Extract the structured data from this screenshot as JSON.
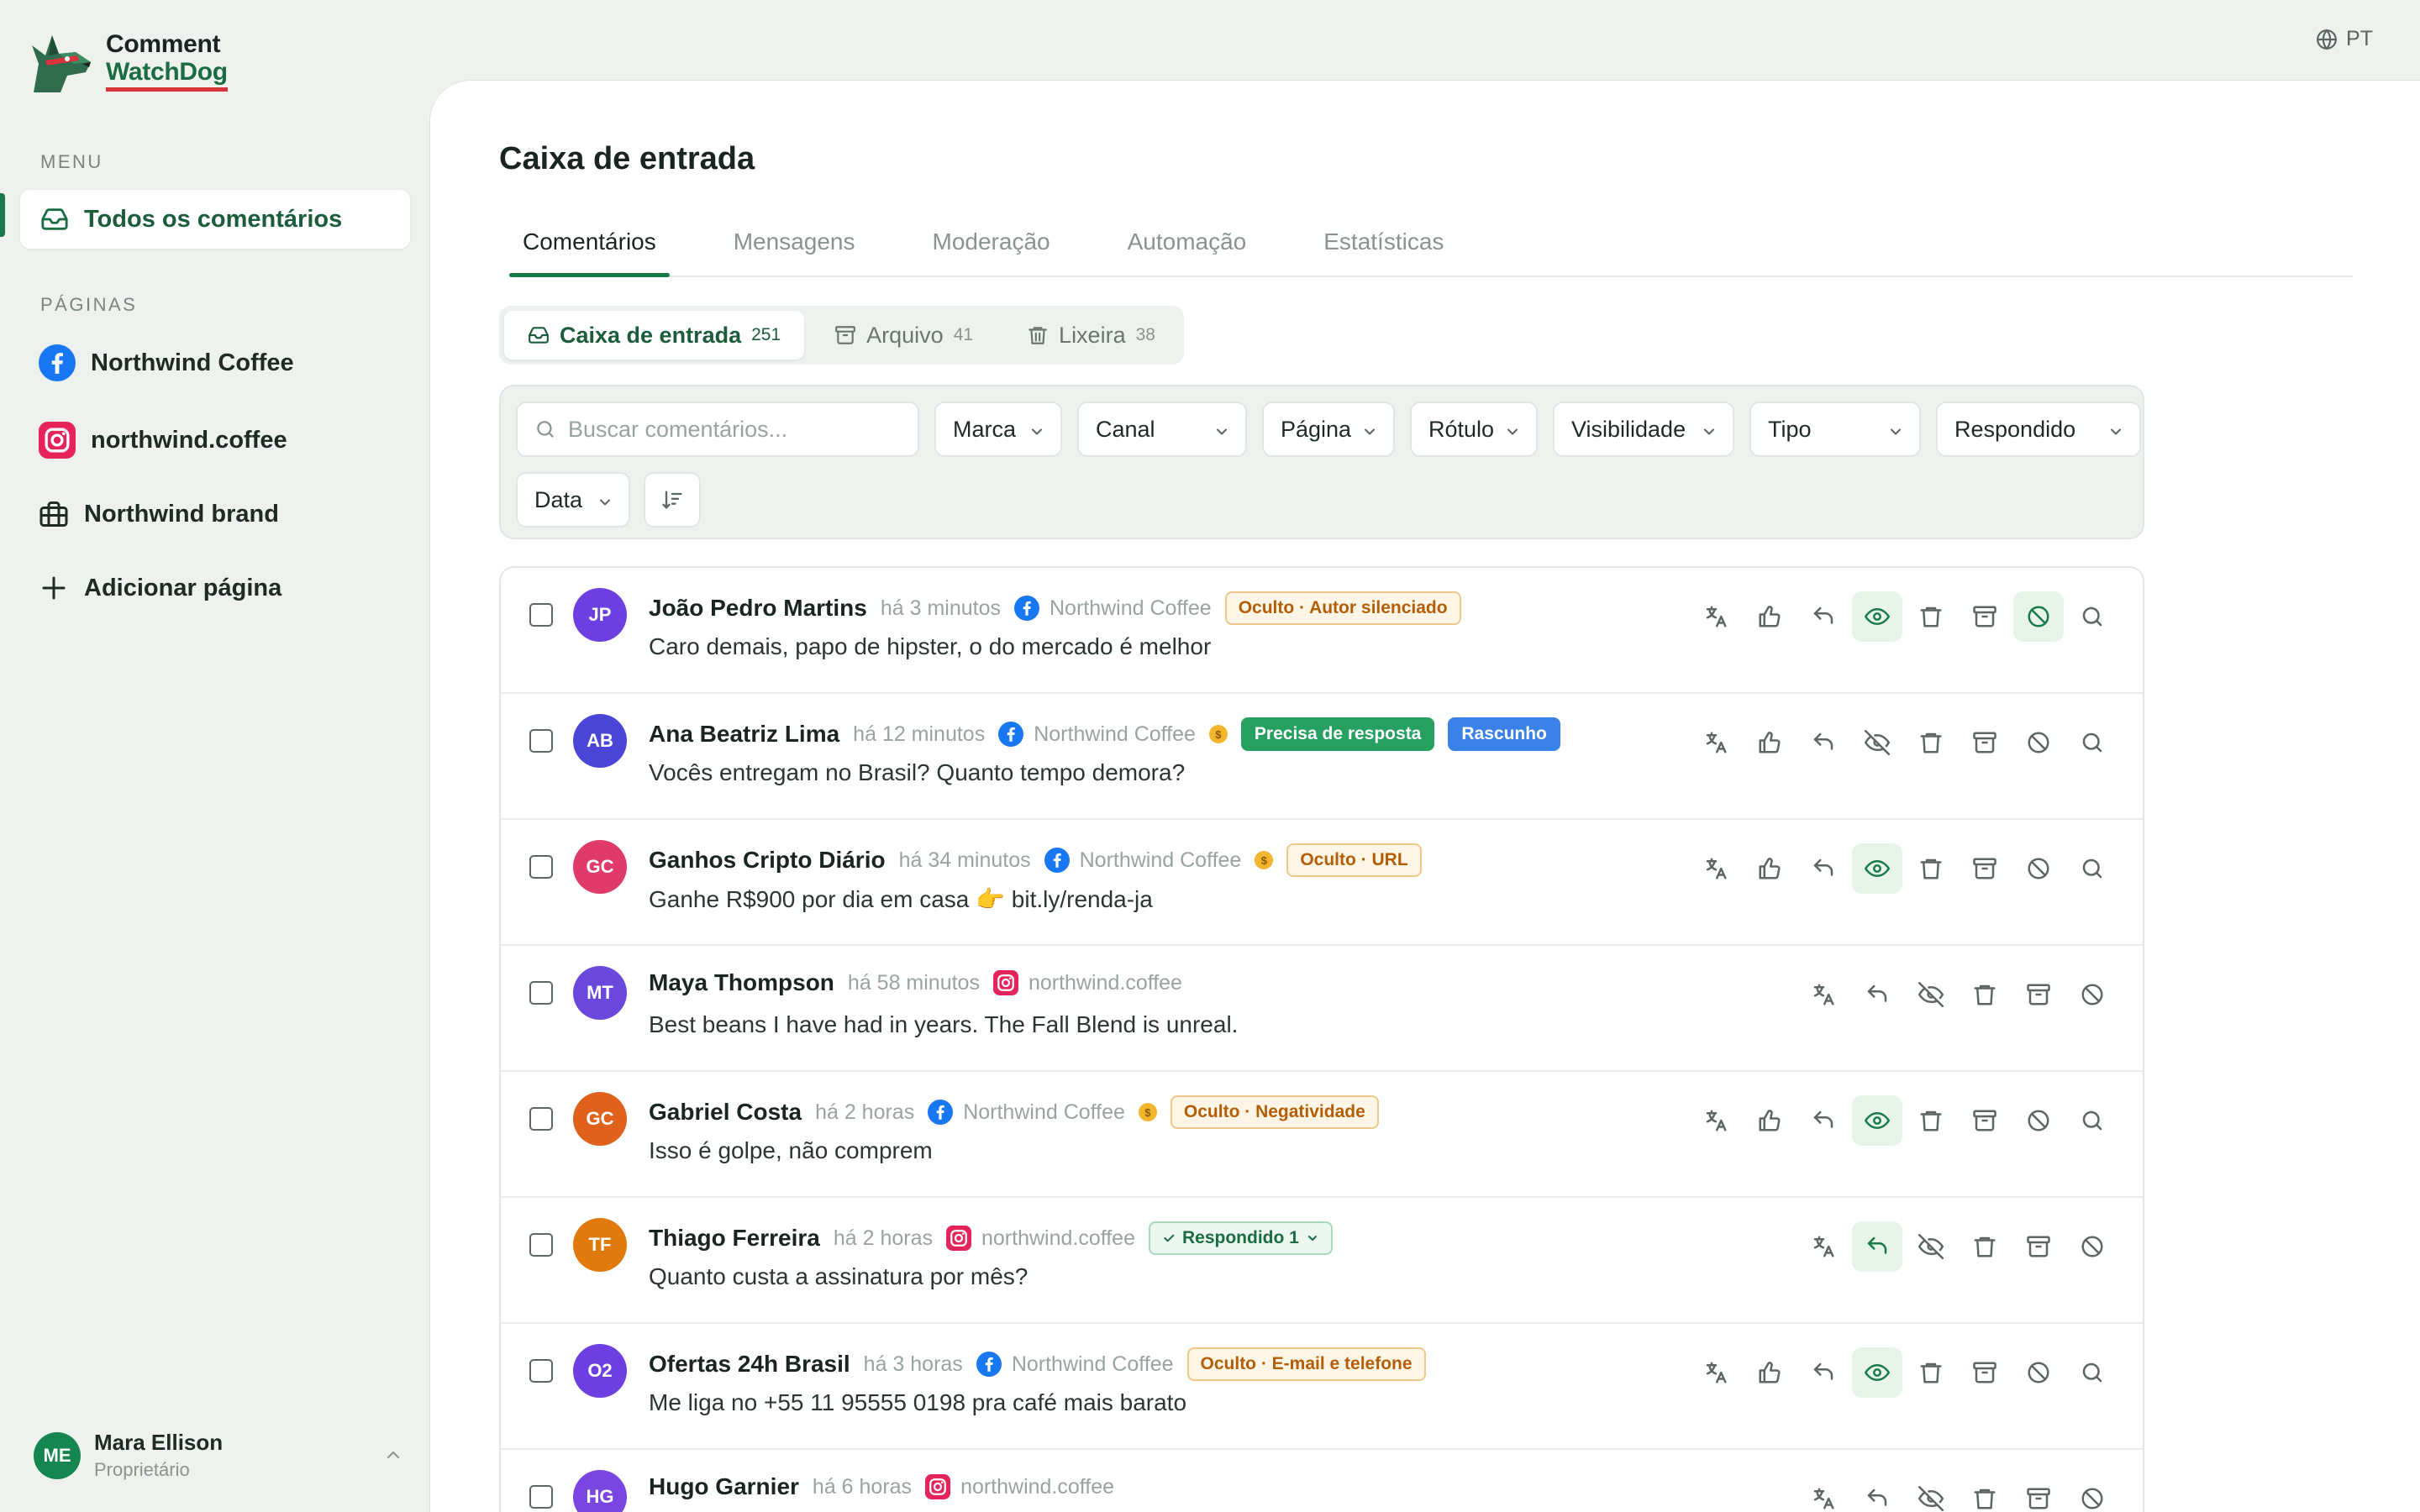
{
  "app": {
    "logo_top": "Comment",
    "logo_bottom": "WatchDog",
    "language": "PT"
  },
  "sidebar": {
    "menu_label": "MENU",
    "all_comments": "Todos os comentários",
    "pages_label": "PÁGINAS",
    "pages": [
      {
        "label": "Northwind Coffee",
        "icon": "facebook-icon"
      },
      {
        "label": "northwind.coffee",
        "icon": "instagram-icon"
      },
      {
        "label": "Northwind brand",
        "icon": "briefcase-icon"
      }
    ],
    "add_page": "Adicionar página",
    "user": {
      "initials": "ME",
      "name": "Mara Ellison",
      "role": "Proprietário"
    }
  },
  "main": {
    "title": "Caixa de entrada",
    "tabs": [
      "Comentários",
      "Mensagens",
      "Moderação",
      "Automação",
      "Estatísticas"
    ],
    "subtabs": [
      {
        "label": "Caixa de entrada",
        "count": "251"
      },
      {
        "label": "Arquivo",
        "count": "41"
      },
      {
        "label": "Lixeira",
        "count": "38"
      }
    ],
    "filters": {
      "search_placeholder": "Buscar comentários...",
      "dropdowns": [
        "Marca",
        "Canal",
        "Página",
        "Rótulo",
        "Visibilidade",
        "Tipo",
        "Respondido",
        "Data"
      ]
    }
  },
  "comments": [
    {
      "initials": "JP",
      "color": "#6d3fe0",
      "name": "João Pedro Martins",
      "time": "há 3 minutos",
      "platform": "facebook",
      "page": "Northwind Coffee",
      "coin": false,
      "badges": [
        {
          "type": "hidden",
          "label": "Oculto · Autor silenciado"
        }
      ],
      "text": "Caro demais, papo de hipster, o do mercado é melhor",
      "active": [
        "eye",
        "ban"
      ],
      "like": true,
      "search": true,
      "eye_state": "eye"
    },
    {
      "initials": "AB",
      "color": "#4a45d6",
      "name": "Ana Beatriz Lima",
      "time": "há 12 minutos",
      "platform": "facebook",
      "page": "Northwind Coffee",
      "coin": true,
      "badges": [
        {
          "type": "need",
          "label": "Precisa de resposta"
        },
        {
          "type": "draft",
          "label": "Rascunho"
        }
      ],
      "text": "Vocês entregam no Brasil? Quanto tempo demora?",
      "active": [],
      "like": true,
      "search": true,
      "eye_state": "eye-off"
    },
    {
      "initials": "GC",
      "color": "#e03a6a",
      "name": "Ganhos Cripto Diário",
      "time": "há 34 minutos",
      "platform": "facebook",
      "page": "Northwind Coffee",
      "coin": true,
      "badges": [
        {
          "type": "hidden",
          "label": "Oculto · URL"
        }
      ],
      "text": "Ganhe R$900 por dia em casa 👉 bit.ly/renda-ja",
      "active": [
        "eye"
      ],
      "like": true,
      "search": true,
      "eye_state": "eye"
    },
    {
      "initials": "MT",
      "color": "#6a48dc",
      "name": "Maya Thompson",
      "time": "há 58 minutos",
      "platform": "instagram",
      "page": "northwind.coffee",
      "coin": false,
      "badges": [],
      "text": "Best beans I have had in years. The Fall Blend is unreal.",
      "active": [],
      "like": false,
      "search": false,
      "eye_state": "eye-off"
    },
    {
      "initials": "GC",
      "color": "#e0611c",
      "name": "Gabriel Costa",
      "time": "há 2 horas",
      "platform": "facebook",
      "page": "Northwind Coffee",
      "coin": true,
      "badges": [
        {
          "type": "hidden",
          "label": "Oculto · Negatividade"
        }
      ],
      "text": "Isso é golpe, não comprem",
      "active": [
        "eye"
      ],
      "like": true,
      "search": true,
      "eye_state": "eye"
    },
    {
      "initials": "TF",
      "color": "#e07a0c",
      "name": "Thiago Ferreira",
      "time": "há 2 horas",
      "platform": "instagram",
      "page": "northwind.coffee",
      "coin": false,
      "badges": [
        {
          "type": "replied",
          "label": "Respondido 1"
        }
      ],
      "text": "Quanto custa a assinatura por mês?",
      "active": [
        "reply"
      ],
      "like": false,
      "search": false,
      "eye_state": "eye-off"
    },
    {
      "initials": "O2",
      "color": "#6d3fe0",
      "name": "Ofertas 24h Brasil",
      "time": "há 3 horas",
      "platform": "facebook",
      "page": "Northwind Coffee",
      "coin": false,
      "badges": [
        {
          "type": "hidden",
          "label": "Oculto · E-mail e telefone"
        }
      ],
      "text": "Me liga no +55 11 95555 0198 pra café mais barato",
      "active": [
        "eye"
      ],
      "like": true,
      "search": true,
      "eye_state": "eye"
    },
    {
      "initials": "HG",
      "color": "#7a45e0",
      "name": "Hugo Garnier",
      "time": "há 6 horas",
      "platform": "instagram",
      "page": "northwind.coffee",
      "coin": false,
      "badges": [],
      "text": "",
      "active": [],
      "like": false,
      "search": false,
      "eye_state": "eye-off"
    }
  ]
}
